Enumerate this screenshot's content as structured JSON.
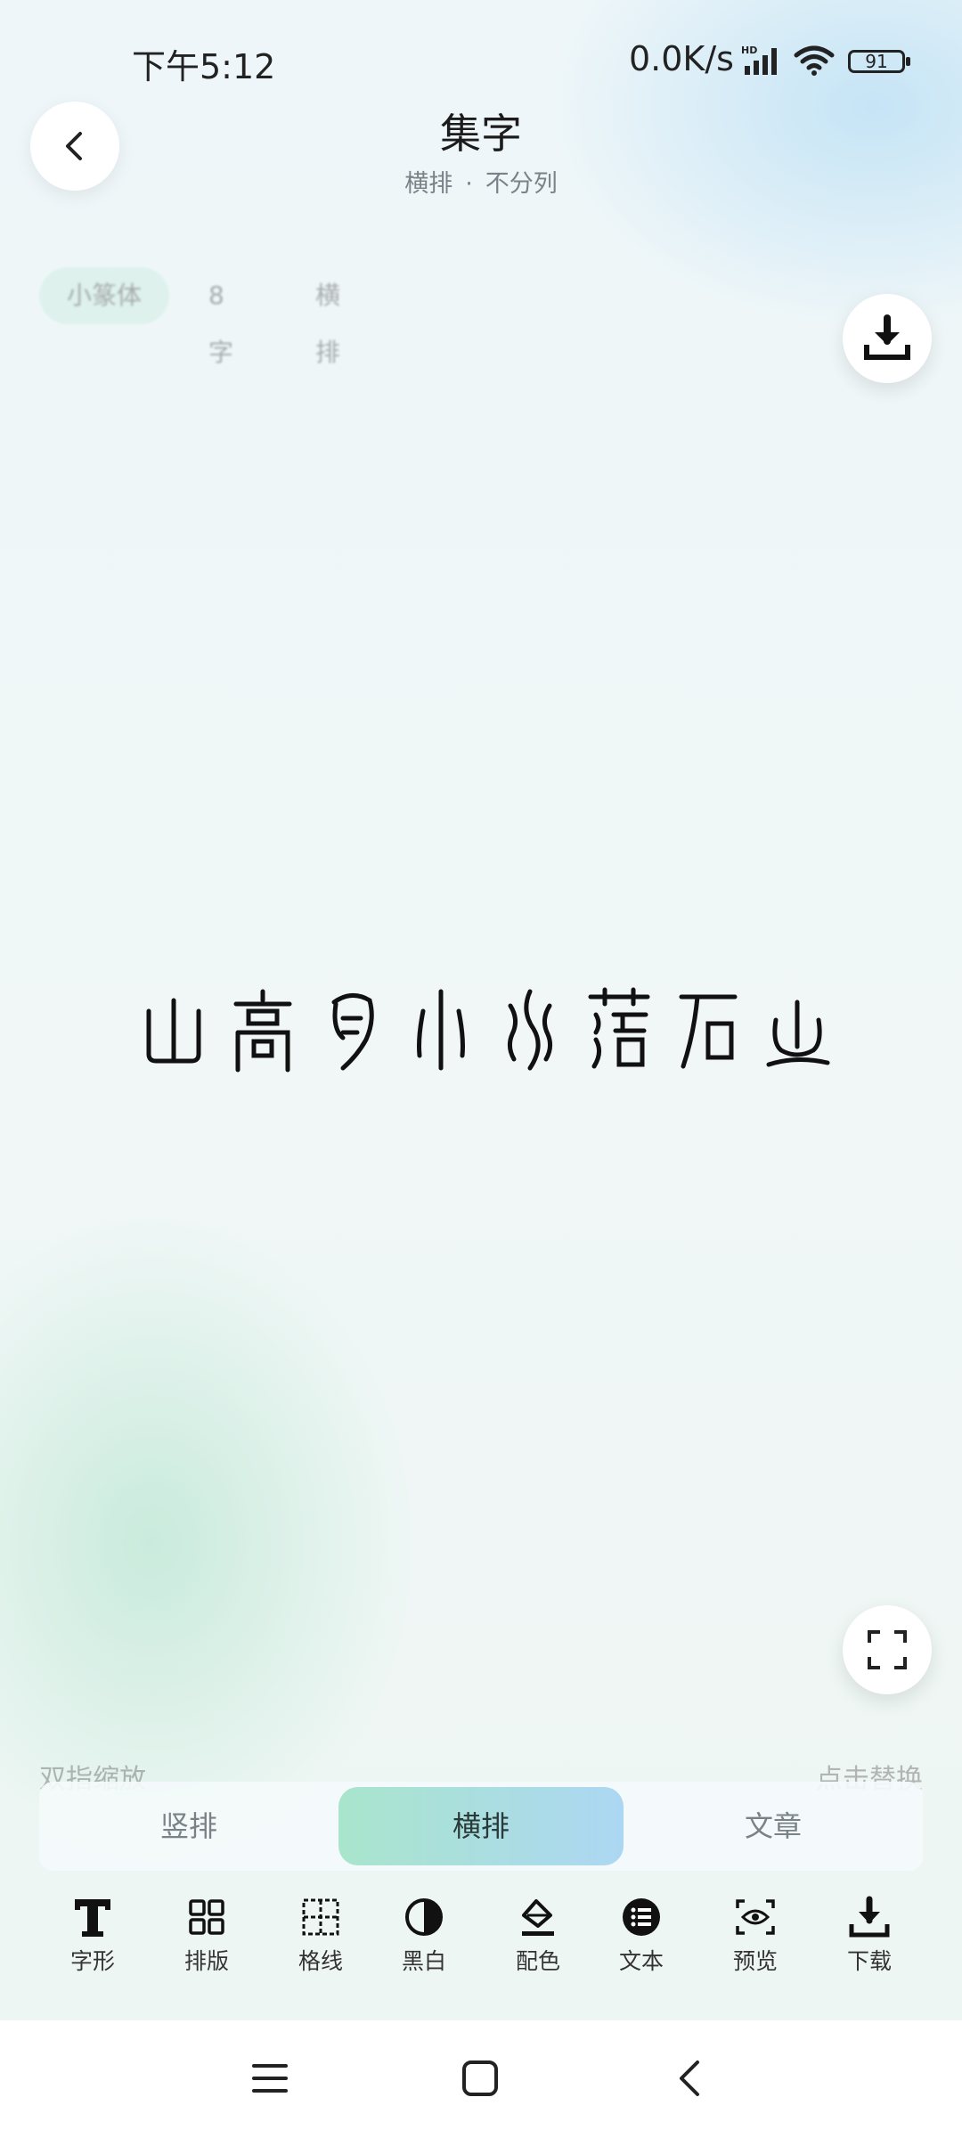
{
  "status_bar": {
    "time": "下午5:12",
    "network_speed": "0.0K/s",
    "signal_tag": "HD",
    "battery": "91"
  },
  "header": {
    "title": "集字",
    "subtitle_a": "横排",
    "subtitle_dot": "·",
    "subtitle_b": "不分列"
  },
  "chips": [
    "小篆体",
    "8字",
    "横排"
  ],
  "glyphs": [
    "山",
    "高",
    "月",
    "小",
    "水",
    "落",
    "石",
    "出"
  ],
  "hints": {
    "left": "双指缩放",
    "right": "点击替换"
  },
  "segments": {
    "vertical": "竖排",
    "horizontal": "横排",
    "article": "文章",
    "selected": "横排"
  },
  "toolbar": {
    "font": "字形",
    "layout": "排版",
    "grid": "格线",
    "bw": "黑白",
    "color": "配色",
    "text": "文本",
    "preview": "预览",
    "download": "下载"
  },
  "icons": [
    "back-icon",
    "download-icon",
    "fullscreen-icon",
    "menu-icon",
    "home-icon",
    "nav-back-icon"
  ]
}
